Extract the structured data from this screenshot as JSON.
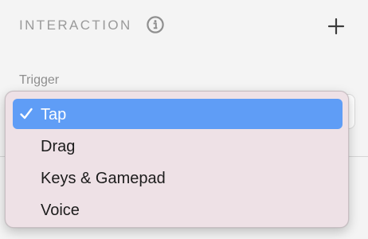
{
  "section": {
    "title": "INTERACTION",
    "info_icon": "info-circle-icon",
    "add_icon": "plus-icon"
  },
  "trigger": {
    "label": "Trigger",
    "selected": "Tap"
  },
  "menu": {
    "items": [
      {
        "label": "Tap",
        "selected": true,
        "icon": "checkmark-icon"
      },
      {
        "label": "Drag",
        "selected": false
      },
      {
        "label": "Keys & Gamepad",
        "selected": false
      },
      {
        "label": "Voice",
        "selected": false
      }
    ]
  },
  "colors": {
    "selection": "#5f9df6",
    "menu_background": "#eee1e6",
    "muted_text": "#9a9a9a"
  }
}
